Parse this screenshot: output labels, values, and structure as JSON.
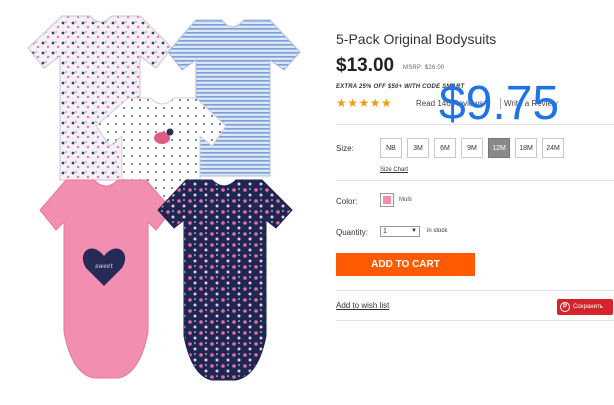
{
  "product": {
    "title": "5-Pack Original Bodysuits",
    "price": "$13.00",
    "msrp": "MSRP: $26.00",
    "promo": "EXTRA 25% OFF $50+ WITH CODE SMART",
    "overlay_price": "$9.75",
    "rating": {
      "stars": "★★★★★",
      "reviews_label": "Read 146 Reviews",
      "write_review_label": "Write a Review"
    }
  },
  "size": {
    "label": "Size:",
    "options": [
      "NB",
      "3M",
      "6M",
      "9M",
      "12M",
      "18M",
      "24M"
    ],
    "selected": "12M",
    "chart_link": "Size Chart"
  },
  "color": {
    "label": "Color:",
    "value": "Multi",
    "swatch_color": "#f38aa8"
  },
  "quantity": {
    "label": "Quantity:",
    "value": "1",
    "stock_status": "in stock"
  },
  "actions": {
    "add_to_cart": "ADD TO CART",
    "wishlist": "Add to wish list",
    "save": "Сохранить"
  },
  "colors": {
    "accent": "#ff5a00",
    "overlay": "#1e73e6",
    "stars": "#f39c12",
    "save": "#d6232b"
  }
}
